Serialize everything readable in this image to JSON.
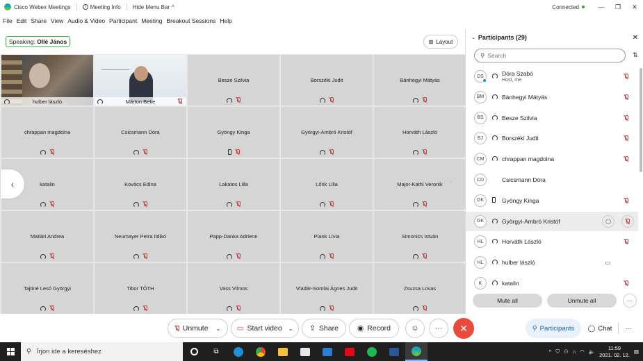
{
  "titlebar": {
    "app_name": "Cisco Webex Meetings",
    "meeting_info": "Meeting Info",
    "hide_menu": "Hide Menu Bar",
    "hide_menu_chevron": "^",
    "status": "Connected",
    "minimize": "—",
    "restore": "❐",
    "close": "✕"
  },
  "menu": [
    "File",
    "Edit",
    "Share",
    "View",
    "Audio & Video",
    "Participant",
    "Meeting",
    "Breakout Sessions",
    "Help"
  ],
  "speaking": {
    "label": "Speaking:",
    "name": "Ollé János"
  },
  "layout_label": "Layout",
  "grid": {
    "video_tiles": [
      {
        "name": "hulber lászló"
      },
      {
        "name": "Márton Beke"
      }
    ],
    "tiles": [
      {
        "name": "Besze Szilvia",
        "device": "audio"
      },
      {
        "name": "Borszéki Judit",
        "device": "audio"
      },
      {
        "name": "Bánhegyi Mátyás",
        "device": "audio"
      },
      {
        "name": "chrappan magdolna",
        "device": "audio"
      },
      {
        "name": "Csicsmann Dóra",
        "device": "audio"
      },
      {
        "name": "Gyöngy Kinga",
        "device": "phone"
      },
      {
        "name": "Györgyi-Ambró Kristóf",
        "device": "audio"
      },
      {
        "name": "Horváth László",
        "device": "audio"
      },
      {
        "name": "katalin",
        "device": "audio"
      },
      {
        "name": "Kovács Edina",
        "device": "audio"
      },
      {
        "name": "Lakatos Lilla",
        "device": "audio"
      },
      {
        "name": "Lőrik Lilla",
        "device": "audio"
      },
      {
        "name": "Major-Kathi Veronik",
        "device": "audio"
      },
      {
        "name": "Matlári Andrea",
        "device": "audio"
      },
      {
        "name": "Neumayer Petra Ildikó",
        "device": "audio"
      },
      {
        "name": "Papp-Danka Adrienn",
        "device": "audio"
      },
      {
        "name": "Plank Lívia",
        "device": "audio"
      },
      {
        "name": "Simonics István",
        "device": "audio"
      },
      {
        "name": "Tajtiné Lesó Györgyi",
        "device": "audio"
      },
      {
        "name": "Tibor TÓTH",
        "device": "audio"
      },
      {
        "name": "Vass Vilmos",
        "device": "audio"
      },
      {
        "name": "Vladár-Somlai Ágnes Judit",
        "device": "audio"
      },
      {
        "name": "Zsuzsa Lovas",
        "device": "audio"
      }
    ],
    "nav_prev": "‹",
    "nav_next": "›"
  },
  "toolbar": {
    "unmute": "Unmute",
    "start_video": "Start video",
    "share": "Share",
    "record": "Record",
    "reactions": "☺",
    "more": "···",
    "end": "✕",
    "participants": "Participants",
    "chat": "Chat",
    "more_right": "···"
  },
  "panel": {
    "title": "Participants (29)",
    "close": "✕",
    "search_placeholder": "Search",
    "participants": [
      {
        "initials": "DS",
        "name": "Dóra Szabó",
        "sub": "Host, me",
        "audio": true,
        "muted": true,
        "host": true
      },
      {
        "initials": "BM",
        "name": "Bánhegyi Mátyás",
        "audio": true,
        "muted": true
      },
      {
        "initials": "BS",
        "name": "Besze Szilvia",
        "audio": true,
        "muted": true
      },
      {
        "initials": "BJ",
        "name": "Borszéki Judit",
        "audio": true,
        "muted": true
      },
      {
        "initials": "CM",
        "name": "chrappan magdolna",
        "audio": true,
        "muted": true
      },
      {
        "initials": "CD",
        "name": "Csicsmann Dóra",
        "audio": false,
        "muted": false
      },
      {
        "initials": "GK",
        "name": "Gyöngy Kinga",
        "phone": true,
        "muted": true
      },
      {
        "initials": "GK",
        "name": "Györgyi-Ambró Kristóf",
        "audio": true,
        "muted": true,
        "highlighted": true
      },
      {
        "initials": "HL",
        "name": "Horváth László",
        "audio": true,
        "muted": true
      },
      {
        "initials": "HL",
        "name": "hulber lászló",
        "audio": true,
        "muted": false,
        "video": true
      },
      {
        "initials": "K",
        "name": "katalin",
        "audio": true,
        "muted": true
      }
    ],
    "mute_all": "Mute all",
    "unmute_all": "Unmute all",
    "more": "···"
  },
  "taskbar": {
    "search_placeholder": "Írjon ide a kereséshez",
    "time": "11:59",
    "date": "2021. 02. 12."
  },
  "colors": {
    "accent_green": "#4caf50",
    "end_red": "#e84a3c",
    "mute_red": "#d33333",
    "tile_gray": "#d5d5d5"
  }
}
